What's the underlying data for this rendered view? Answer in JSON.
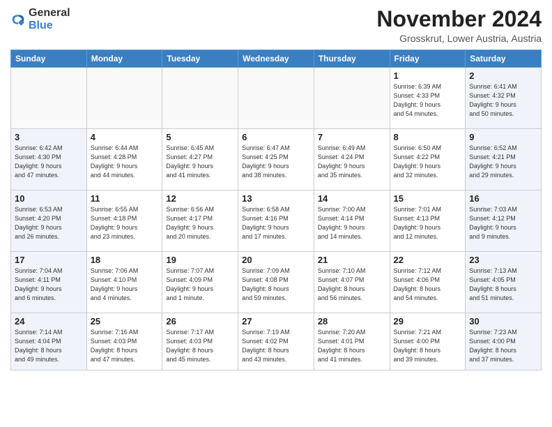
{
  "logo": {
    "general": "General",
    "blue": "Blue"
  },
  "header": {
    "month": "November 2024",
    "location": "Grosskrut, Lower Austria, Austria"
  },
  "weekdays": [
    "Sunday",
    "Monday",
    "Tuesday",
    "Wednesday",
    "Thursday",
    "Friday",
    "Saturday"
  ],
  "weeks": [
    [
      {
        "day": "",
        "info": ""
      },
      {
        "day": "",
        "info": ""
      },
      {
        "day": "",
        "info": ""
      },
      {
        "day": "",
        "info": ""
      },
      {
        "day": "",
        "info": ""
      },
      {
        "day": "1",
        "info": "Sunrise: 6:39 AM\nSunset: 4:33 PM\nDaylight: 9 hours\nand 54 minutes."
      },
      {
        "day": "2",
        "info": "Sunrise: 6:41 AM\nSunset: 4:32 PM\nDaylight: 9 hours\nand 50 minutes."
      }
    ],
    [
      {
        "day": "3",
        "info": "Sunrise: 6:42 AM\nSunset: 4:30 PM\nDaylight: 9 hours\nand 47 minutes."
      },
      {
        "day": "4",
        "info": "Sunrise: 6:44 AM\nSunset: 4:28 PM\nDaylight: 9 hours\nand 44 minutes."
      },
      {
        "day": "5",
        "info": "Sunrise: 6:45 AM\nSunset: 4:27 PM\nDaylight: 9 hours\nand 41 minutes."
      },
      {
        "day": "6",
        "info": "Sunrise: 6:47 AM\nSunset: 4:25 PM\nDaylight: 9 hours\nand 38 minutes."
      },
      {
        "day": "7",
        "info": "Sunrise: 6:49 AM\nSunset: 4:24 PM\nDaylight: 9 hours\nand 35 minutes."
      },
      {
        "day": "8",
        "info": "Sunrise: 6:50 AM\nSunset: 4:22 PM\nDaylight: 9 hours\nand 32 minutes."
      },
      {
        "day": "9",
        "info": "Sunrise: 6:52 AM\nSunset: 4:21 PM\nDaylight: 9 hours\nand 29 minutes."
      }
    ],
    [
      {
        "day": "10",
        "info": "Sunrise: 6:53 AM\nSunset: 4:20 PM\nDaylight: 9 hours\nand 26 minutes."
      },
      {
        "day": "11",
        "info": "Sunrise: 6:55 AM\nSunset: 4:18 PM\nDaylight: 9 hours\nand 23 minutes."
      },
      {
        "day": "12",
        "info": "Sunrise: 6:56 AM\nSunset: 4:17 PM\nDaylight: 9 hours\nand 20 minutes."
      },
      {
        "day": "13",
        "info": "Sunrise: 6:58 AM\nSunset: 4:16 PM\nDaylight: 9 hours\nand 17 minutes."
      },
      {
        "day": "14",
        "info": "Sunrise: 7:00 AM\nSunset: 4:14 PM\nDaylight: 9 hours\nand 14 minutes."
      },
      {
        "day": "15",
        "info": "Sunrise: 7:01 AM\nSunset: 4:13 PM\nDaylight: 9 hours\nand 12 minutes."
      },
      {
        "day": "16",
        "info": "Sunrise: 7:03 AM\nSunset: 4:12 PM\nDaylight: 9 hours\nand 9 minutes."
      }
    ],
    [
      {
        "day": "17",
        "info": "Sunrise: 7:04 AM\nSunset: 4:11 PM\nDaylight: 9 hours\nand 6 minutes."
      },
      {
        "day": "18",
        "info": "Sunrise: 7:06 AM\nSunset: 4:10 PM\nDaylight: 9 hours\nand 4 minutes."
      },
      {
        "day": "19",
        "info": "Sunrise: 7:07 AM\nSunset: 4:09 PM\nDaylight: 9 hours\nand 1 minute."
      },
      {
        "day": "20",
        "info": "Sunrise: 7:09 AM\nSunset: 4:08 PM\nDaylight: 8 hours\nand 59 minutes."
      },
      {
        "day": "21",
        "info": "Sunrise: 7:10 AM\nSunset: 4:07 PM\nDaylight: 8 hours\nand 56 minutes."
      },
      {
        "day": "22",
        "info": "Sunrise: 7:12 AM\nSunset: 4:06 PM\nDaylight: 8 hours\nand 54 minutes."
      },
      {
        "day": "23",
        "info": "Sunrise: 7:13 AM\nSunset: 4:05 PM\nDaylight: 8 hours\nand 51 minutes."
      }
    ],
    [
      {
        "day": "24",
        "info": "Sunrise: 7:14 AM\nSunset: 4:04 PM\nDaylight: 8 hours\nand 49 minutes."
      },
      {
        "day": "25",
        "info": "Sunrise: 7:16 AM\nSunset: 4:03 PM\nDaylight: 8 hours\nand 47 minutes."
      },
      {
        "day": "26",
        "info": "Sunrise: 7:17 AM\nSunset: 4:03 PM\nDaylight: 8 hours\nand 45 minutes."
      },
      {
        "day": "27",
        "info": "Sunrise: 7:19 AM\nSunset: 4:02 PM\nDaylight: 8 hours\nand 43 minutes."
      },
      {
        "day": "28",
        "info": "Sunrise: 7:20 AM\nSunset: 4:01 PM\nDaylight: 8 hours\nand 41 minutes."
      },
      {
        "day": "29",
        "info": "Sunrise: 7:21 AM\nSunset: 4:00 PM\nDaylight: 8 hours\nand 39 minutes."
      },
      {
        "day": "30",
        "info": "Sunrise: 7:23 AM\nSunset: 4:00 PM\nDaylight: 8 hours\nand 37 minutes."
      }
    ]
  ]
}
